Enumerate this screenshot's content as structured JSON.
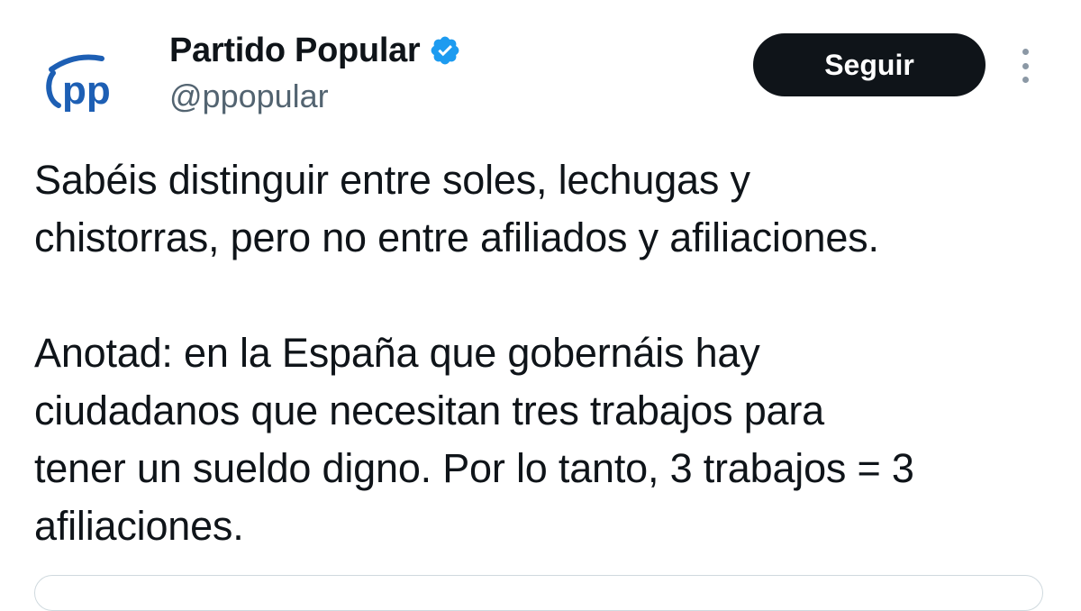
{
  "tweet": {
    "author": {
      "display_name": "Partido Popular",
      "handle": "@ppopular",
      "verified": true,
      "avatar_logo_text": "pp",
      "brand_color": "#1d5fb4",
      "verified_color": "#1d9bf0"
    },
    "follow_label": "Seguir",
    "more_icon": "more-vertical-icon",
    "text_paragraph_1": "Sabéis distinguir entre soles, lechugas y\nchistorras, pero no entre afiliados y afiliaciones.",
    "text_paragraph_2": "Anotad: en la España que gobernáis hay\nciudadanos que necesitan tres trabajos para\ntener un sueldo digno. Por lo tanto, 3 trabajos = 3\nafiliaciones."
  }
}
